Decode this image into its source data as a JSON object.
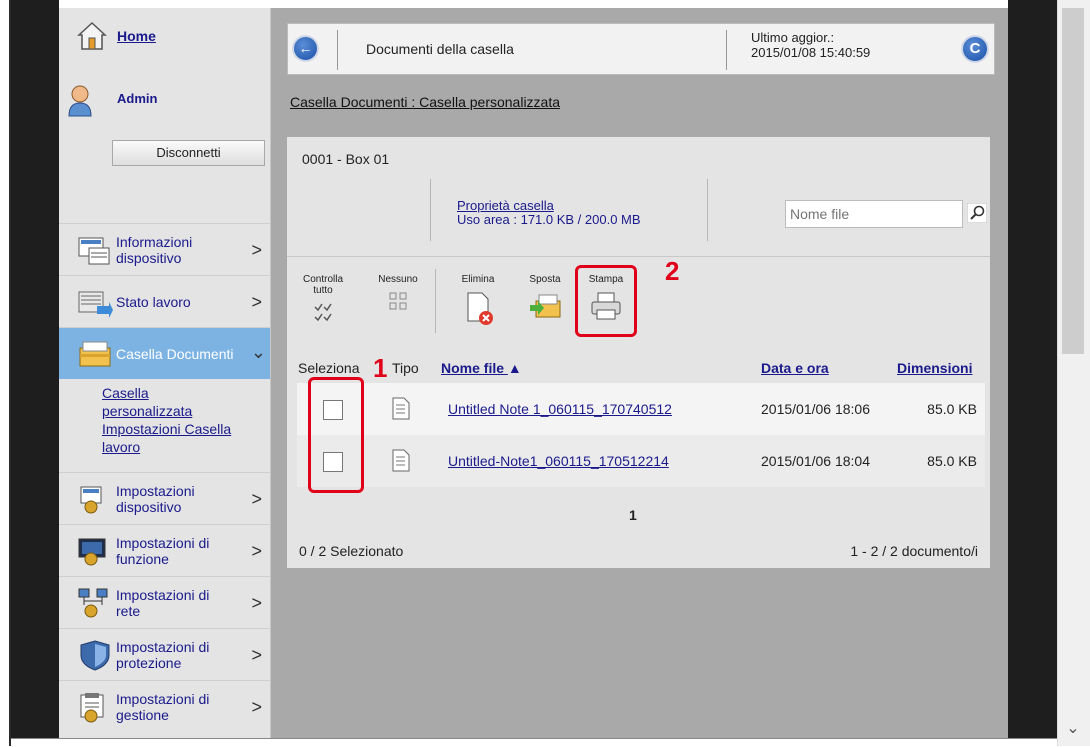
{
  "sidebar": {
    "home_label": "Home",
    "user_name": "Admin",
    "logout_label": "Disconnetti",
    "items": [
      {
        "label": "Informazioni dispositivo",
        "icon": "device-info-icon"
      },
      {
        "label": "Stato lavoro",
        "icon": "job-status-icon"
      },
      {
        "label": "Casella Documenti",
        "icon": "document-box-icon",
        "active": true
      },
      {
        "label": "Impostazioni dispositivo",
        "icon": "device-settings-icon"
      },
      {
        "label": "Impostazioni di funzione",
        "icon": "function-settings-icon"
      },
      {
        "label": "Impostazioni di rete",
        "icon": "network-settings-icon"
      },
      {
        "label": "Impostazioni di protezione",
        "icon": "security-settings-icon"
      },
      {
        "label": "Impostazioni di gestione",
        "icon": "management-settings-icon"
      }
    ],
    "sub_links": [
      "Casella personalizzata",
      "Impostazioni Casella lavoro"
    ]
  },
  "header": {
    "title": "Documenti della casella",
    "last_update_label": "Ultimo aggior.:",
    "last_update_value": "2015/01/08 15:40:59"
  },
  "breadcrumb": "Casella Documenti : Casella personalizzata",
  "box": {
    "title": "0001 - Box 01",
    "properties_link": "Proprietà casella",
    "usage": "Uso area : 171.0 KB / 200.0 MB",
    "search_placeholder": "Nome file"
  },
  "toolbar": {
    "check_all": "Controlla tutto",
    "none": "Nessuno",
    "delete": "Elimina",
    "move": "Sposta",
    "print": "Stampa"
  },
  "callouts": {
    "one": "1",
    "two": "2"
  },
  "table": {
    "headers": {
      "select": "Seleziona",
      "type": "Tipo",
      "filename": "Nome file",
      "date": "Data e ora",
      "size": "Dimensioni"
    },
    "rows": [
      {
        "filename": "Untitled Note 1_060115_170740512",
        "date": "2015/01/06 18:06",
        "size": "85.0 KB",
        "checked": false
      },
      {
        "filename": "Untitled-Note1_060115_170512214",
        "date": "2015/01/06 18:04",
        "size": "85.0 KB",
        "checked": false
      }
    ],
    "page": "1",
    "selected_count": "0 / 2 Selezionato",
    "doc_count": "1 - 2 / 2 documento/i"
  },
  "colors": {
    "accent": "#7db3e3",
    "callout": "#e0001a",
    "link": "#1a1a8c"
  }
}
